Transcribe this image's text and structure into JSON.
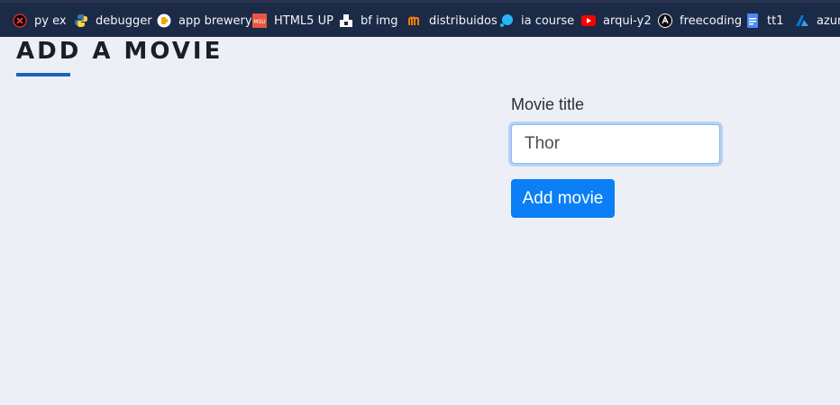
{
  "bookmarks": [
    {
      "label": "py ex",
      "icon": "pyexercise-icon"
    },
    {
      "label": "debugger",
      "icon": "python-icon"
    },
    {
      "label": "app brewery",
      "icon": "app-brewery-icon"
    },
    {
      "label": "HTML5 UP",
      "icon": "html5up-icon"
    },
    {
      "label": "bf img",
      "icon": "bf-img-icon"
    },
    {
      "label": "distribuidos",
      "icon": "distribuidos-icon"
    },
    {
      "label": "ia course",
      "icon": "ia-course-icon"
    },
    {
      "label": "arqui-y2",
      "icon": "youtube-icon"
    },
    {
      "label": "freecoding",
      "icon": "freecoding-icon"
    },
    {
      "label": "tt1",
      "icon": "docs-icon"
    },
    {
      "label": "azure",
      "icon": "azure-icon"
    }
  ],
  "page": {
    "title": "ADD A MOVIE",
    "accent_color": "#1565c0"
  },
  "form": {
    "movie_title_label": "Movie title",
    "movie_title_value": "Thor",
    "submit_label": "Add movie",
    "submit_color": "#0b7ff5"
  }
}
